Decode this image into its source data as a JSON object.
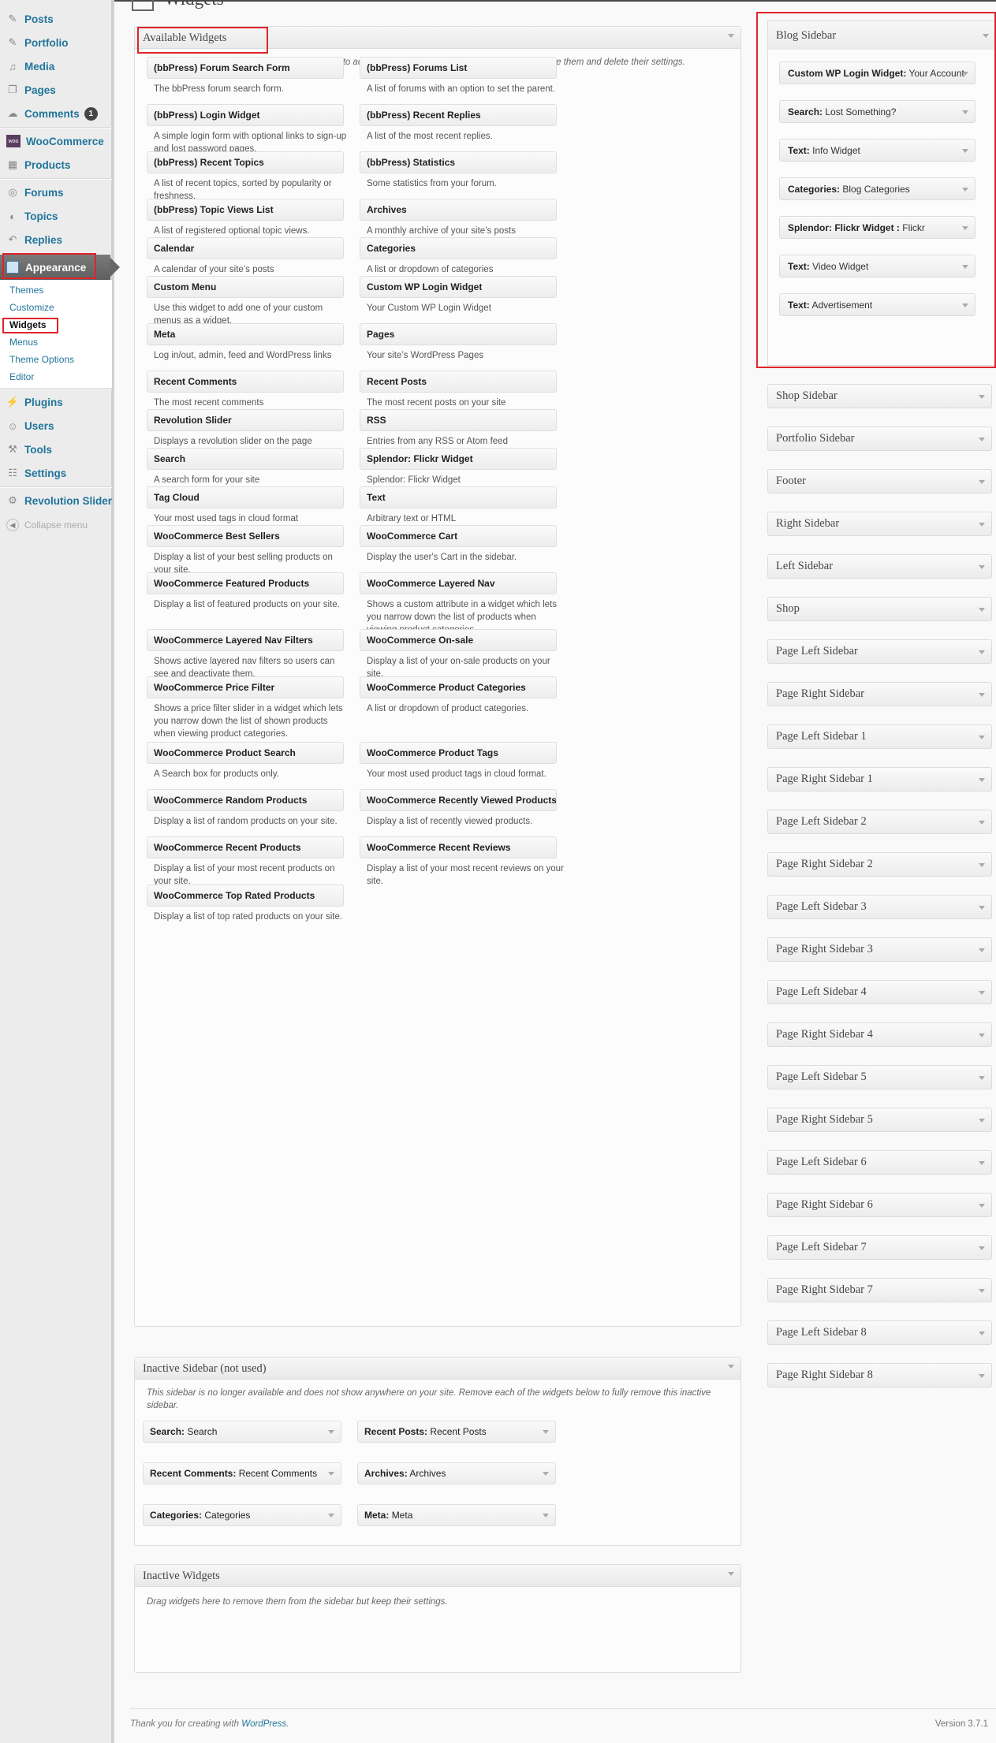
{
  "menu": {
    "items": [
      {
        "label": "Posts",
        "icon": "pin-icon"
      },
      {
        "label": "Portfolio",
        "icon": "pin-icon"
      },
      {
        "label": "Media",
        "icon": "media-icon"
      },
      {
        "label": "Pages",
        "icon": "pages-icon"
      },
      {
        "label": "Comments",
        "icon": "comments-icon",
        "badge": "1"
      },
      {
        "label": "WooCommerce",
        "icon": "woo-icon"
      },
      {
        "label": "Products",
        "icon": "products-icon"
      },
      {
        "label": "Forums",
        "icon": "forums-icon"
      },
      {
        "label": "Topics",
        "icon": "topics-icon"
      },
      {
        "label": "Replies",
        "icon": "replies-icon"
      },
      {
        "label": "Appearance",
        "icon": "appearance-icon"
      },
      {
        "label": "Plugins",
        "icon": "plugins-icon"
      },
      {
        "label": "Users",
        "icon": "users-icon"
      },
      {
        "label": "Tools",
        "icon": "tools-icon"
      },
      {
        "label": "Settings",
        "icon": "settings-icon"
      },
      {
        "label": "Revolution Slider",
        "icon": "gear-icon"
      },
      {
        "label": "Collapse menu",
        "icon": "collapse-icon"
      }
    ],
    "submenu": [
      "Themes",
      "Customize",
      "Widgets",
      "Menus",
      "Theme Options",
      "Editor"
    ]
  },
  "page": {
    "title": "Widgets"
  },
  "available": {
    "title": "Available Widgets",
    "description": "Drag widgets from here to a sidebar on the right to activate them. Drag widgets back here to deactivate them and delete their settings.",
    "widgets": [
      {
        "title": "(bbPress) Forum Search Form",
        "desc": "The bbPress forum search form."
      },
      {
        "title": "(bbPress) Forums List",
        "desc": "A list of forums with an option to set the parent."
      },
      {
        "title": "(bbPress) Login Widget",
        "desc": "A simple login form with optional links to sign-up and lost password pages."
      },
      {
        "title": "(bbPress) Recent Replies",
        "desc": "A list of the most recent replies."
      },
      {
        "title": "(bbPress) Recent Topics",
        "desc": "A list of recent topics, sorted by popularity or freshness."
      },
      {
        "title": "(bbPress) Statistics",
        "desc": "Some statistics from your forum."
      },
      {
        "title": "(bbPress) Topic Views List",
        "desc": "A list of registered optional topic views."
      },
      {
        "title": "Archives",
        "desc": "A monthly archive of your site’s posts"
      },
      {
        "title": "Calendar",
        "desc": "A calendar of your site’s posts"
      },
      {
        "title": "Categories",
        "desc": "A list or dropdown of categories"
      },
      {
        "title": "Custom Menu",
        "desc": "Use this widget to add one of your custom menus as a widget."
      },
      {
        "title": "Custom WP Login Widget",
        "desc": "Your Custom WP Login Widget"
      },
      {
        "title": "Meta",
        "desc": "Log in/out, admin, feed and WordPress links"
      },
      {
        "title": "Pages",
        "desc": "Your site’s WordPress Pages"
      },
      {
        "title": "Recent Comments",
        "desc": "The most recent comments"
      },
      {
        "title": "Recent Posts",
        "desc": "The most recent posts on your site"
      },
      {
        "title": "Revolution Slider",
        "desc": "Displays a revolution slider on the page"
      },
      {
        "title": "RSS",
        "desc": "Entries from any RSS or Atom feed"
      },
      {
        "title": "Search",
        "desc": "A search form for your site"
      },
      {
        "title": "Splendor: Flickr Widget",
        "desc": "Splendor: Flickr Widget"
      },
      {
        "title": "Tag Cloud",
        "desc": "Your most used tags in cloud format"
      },
      {
        "title": "Text",
        "desc": "Arbitrary text or HTML"
      },
      {
        "title": "WooCommerce Best Sellers",
        "desc": "Display a list of your best selling products on your site."
      },
      {
        "title": "WooCommerce Cart",
        "desc": "Display the user's Cart in the sidebar."
      },
      {
        "title": "WooCommerce Featured Products",
        "desc": "Display a list of featured products on your site."
      },
      {
        "title": "WooCommerce Layered Nav",
        "desc": "Shows a custom attribute in a widget which lets you narrow down the list of products when viewing product categories."
      },
      {
        "title": "WooCommerce Layered Nav Filters",
        "desc": "Shows active layered nav filters so users can see and deactivate them."
      },
      {
        "title": "WooCommerce On-sale",
        "desc": "Display a list of your on-sale products on your site."
      },
      {
        "title": "WooCommerce Price Filter",
        "desc": "Shows a price filter slider in a widget which lets you narrow down the list of shown products when viewing product categories."
      },
      {
        "title": "WooCommerce Product Categories",
        "desc": "A list or dropdown of product categories."
      },
      {
        "title": "WooCommerce Product Search",
        "desc": "A Search box for products only."
      },
      {
        "title": "WooCommerce Product Tags",
        "desc": "Your most used product tags in cloud format."
      },
      {
        "title": "WooCommerce Random Products",
        "desc": "Display a list of random products on your site."
      },
      {
        "title": "WooCommerce Recently Viewed Products",
        "desc": "Display a list of recently viewed products."
      },
      {
        "title": "WooCommerce Recent Products",
        "desc": "Display a list of your most recent products on your site."
      },
      {
        "title": "WooCommerce Recent Reviews",
        "desc": "Display a list of your most recent reviews on your site."
      },
      {
        "title": "WooCommerce Top Rated Products",
        "desc": "Display a list of top rated products on your site."
      }
    ]
  },
  "inactive_sidebar": {
    "title": "Inactive Sidebar (not used)",
    "description": "This sidebar is no longer available and does not show anywhere on your site. Remove each of the widgets below to fully remove this inactive sidebar.",
    "widgets": [
      {
        "type": "Search:",
        "name": "Search"
      },
      {
        "type": "Recent Posts:",
        "name": "Recent Posts"
      },
      {
        "type": "Recent Comments:",
        "name": "Recent Comments"
      },
      {
        "type": "Archives:",
        "name": "Archives"
      },
      {
        "type": "Categories:",
        "name": "Categories"
      },
      {
        "type": "Meta:",
        "name": "Meta"
      }
    ]
  },
  "inactive_widgets": {
    "title": "Inactive Widgets",
    "description": "Drag widgets here to remove them from the sidebar but keep their settings."
  },
  "blog_sidebar": {
    "title": "Blog Sidebar",
    "widgets": [
      {
        "type": "Custom WP Login Widget:",
        "name": "Your Account"
      },
      {
        "type": "Search:",
        "name": "Lost Something?"
      },
      {
        "type": "Text:",
        "name": "Info Widget"
      },
      {
        "type": "Categories:",
        "name": "Blog Categories"
      },
      {
        "type": "Splendor: Flickr Widget :",
        "name": "Flickr"
      },
      {
        "type": "Text:",
        "name": "Video Widget"
      },
      {
        "type": "Text:",
        "name": "Advertisement"
      }
    ]
  },
  "sidebars": [
    "Shop Sidebar",
    "Portfolio Sidebar",
    "Footer",
    "Right Sidebar",
    "Left Sidebar",
    "Shop",
    "Page Left Sidebar",
    "Page Right Sidebar",
    "Page Left Sidebar 1",
    "Page Right Sidebar 1",
    "Page Left Sidebar 2",
    "Page Right Sidebar 2",
    "Page Left Sidebar 3",
    "Page Right Sidebar 3",
    "Page Left Sidebar 4",
    "Page Right Sidebar 4",
    "Page Left Sidebar 5",
    "Page Right Sidebar 5",
    "Page Left Sidebar 6",
    "Page Right Sidebar 6",
    "Page Left Sidebar 7",
    "Page Right Sidebar 7",
    "Page Left Sidebar 8",
    "Page Right Sidebar 8"
  ],
  "footer": {
    "thanks": "Thank you for creating with",
    "link": "WordPress",
    "version": "Version 3.7.1"
  },
  "colors": {
    "link": "#21759b",
    "highlight": "#e0242a",
    "current_menu": "#6e6e6e"
  }
}
